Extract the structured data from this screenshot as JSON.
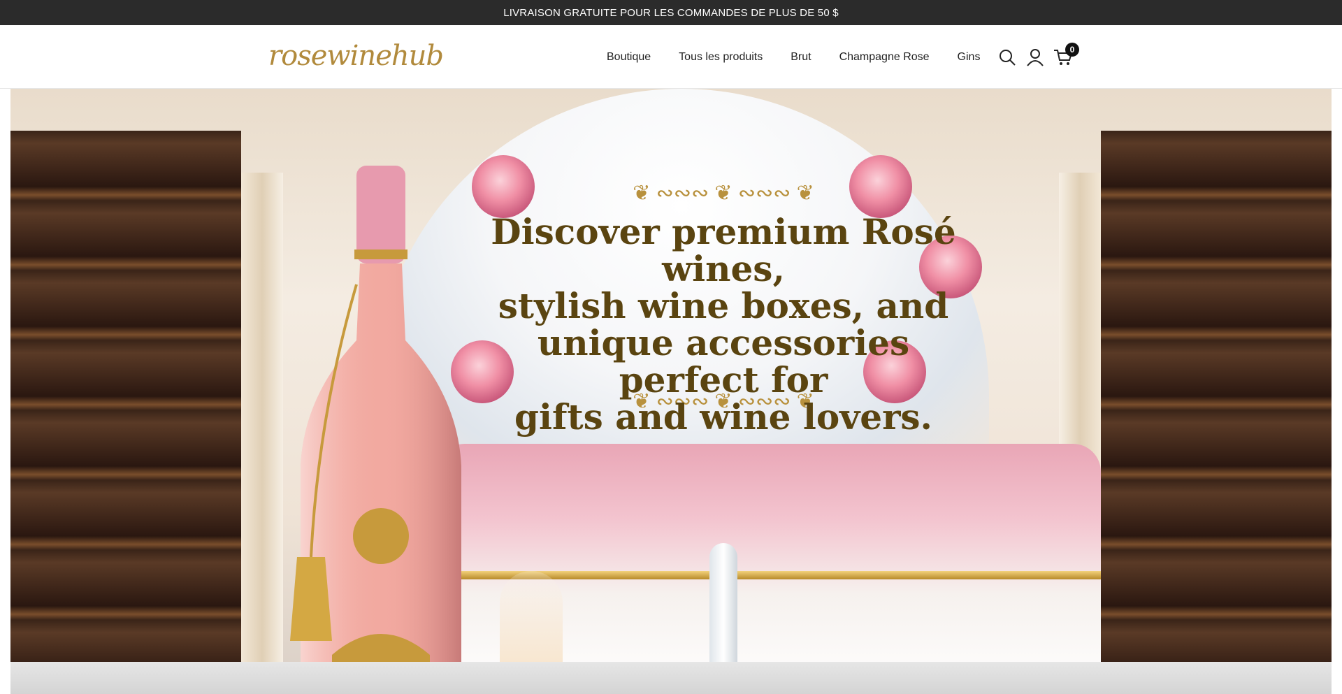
{
  "announcement": "LIVRAISON GRATUITE POUR LES COMMANDES DE PLUS DE 50 $",
  "logo": {
    "text": "rosewinehub",
    "icon": "rose-wine-glass-icon"
  },
  "nav": [
    {
      "label": "Boutique"
    },
    {
      "label": "Tous les produits"
    },
    {
      "label": "Brut"
    },
    {
      "label": "Champagne Rose"
    },
    {
      "label": "Gins"
    }
  ],
  "header_icons": {
    "search": "search-icon",
    "account": "user-icon",
    "cart": "cart-icon",
    "cart_count": "0"
  },
  "hero": {
    "line1": "Discover premium Rosé wines,",
    "line2": "stylish wine boxes, and",
    "line3": "unique accessories perfect for",
    "line4": "gifts and wine lovers."
  },
  "colors": {
    "announcement_bg": "#2b2b2b",
    "logo_gold": "#b18a3c",
    "hero_text": "#5a4410",
    "rose_pink": "#f08fa5"
  }
}
